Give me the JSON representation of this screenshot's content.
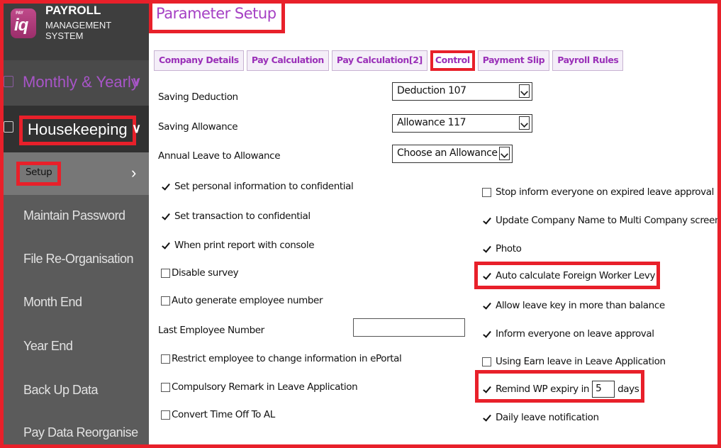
{
  "brand": {
    "logo_small": "PAY",
    "logo_big": "iq",
    "title": "PAYROLL",
    "subtitle": "MANAGEMENT SYSTEM"
  },
  "sidebar": {
    "monthly": {
      "label": "Monthly & Yearly",
      "icon": "calendar-icon"
    },
    "housekeeping": {
      "label": "Housekeeping",
      "icon": "user-card-icon"
    },
    "items": [
      {
        "label": "Setup"
      },
      {
        "label": "Maintain Password"
      },
      {
        "label": "File Re-Organisation"
      },
      {
        "label": "Month End"
      },
      {
        "label": "Year End"
      },
      {
        "label": "Back Up Data"
      },
      {
        "label": "Pay Data Reorganise"
      }
    ]
  },
  "page": {
    "title": "Parameter Setup"
  },
  "tabs": [
    {
      "label": "Company Details"
    },
    {
      "label": "Pay Calculation"
    },
    {
      "label": "Pay Calculation[2]"
    },
    {
      "label": "Control",
      "active": true
    },
    {
      "label": "Payment Slip"
    },
    {
      "label": "Payroll Rules"
    }
  ],
  "form": {
    "saving_deduction": {
      "label": "Saving Deduction",
      "value": "Deduction 107"
    },
    "saving_allowance": {
      "label": "Saving Allowance",
      "value": "Allowance 117"
    },
    "annual_leave": {
      "label": "Annual Leave to Allowance",
      "value": "Choose an Allowance"
    },
    "last_employee_number": {
      "label": "Last Employee Number",
      "value": ""
    },
    "left_checks": [
      {
        "label": "Set personal information to confidential",
        "checked": true
      },
      {
        "label": "Set transaction to confidential",
        "checked": true
      },
      {
        "label": "When print report with console",
        "checked": true
      },
      {
        "label": "Disable survey",
        "checked": false
      },
      {
        "label": "Auto generate employee number",
        "checked": false
      },
      {
        "label": "Restrict employee to change information in ePortal",
        "checked": false
      },
      {
        "label": "Compulsory Remark in Leave Application",
        "checked": false
      },
      {
        "label": "Convert Time Off To AL",
        "checked": false
      }
    ],
    "right_checks": [
      {
        "label": "Stop inform everyone on expired leave approval",
        "checked": false
      },
      {
        "label": "Update Company Name to Multi Company screen",
        "checked": true
      },
      {
        "label": "Photo",
        "checked": true
      },
      {
        "label": "Auto calculate Foreign Worker Levy",
        "checked": true
      },
      {
        "label": "Allow leave key in more than balance",
        "checked": true
      },
      {
        "label": "Inform everyone on leave approval",
        "checked": true
      },
      {
        "label": "Using Earn leave in Leave Application",
        "checked": false
      },
      {
        "label": "Daily leave notification",
        "checked": true
      }
    ],
    "remind_wp": {
      "prefix": "Remind WP expiry in",
      "value": "5",
      "suffix": "days",
      "checked": true
    }
  },
  "colors": {
    "accent": "#a540c4",
    "highlight": "#e8202a",
    "sidebar": "#5b5b5b"
  }
}
